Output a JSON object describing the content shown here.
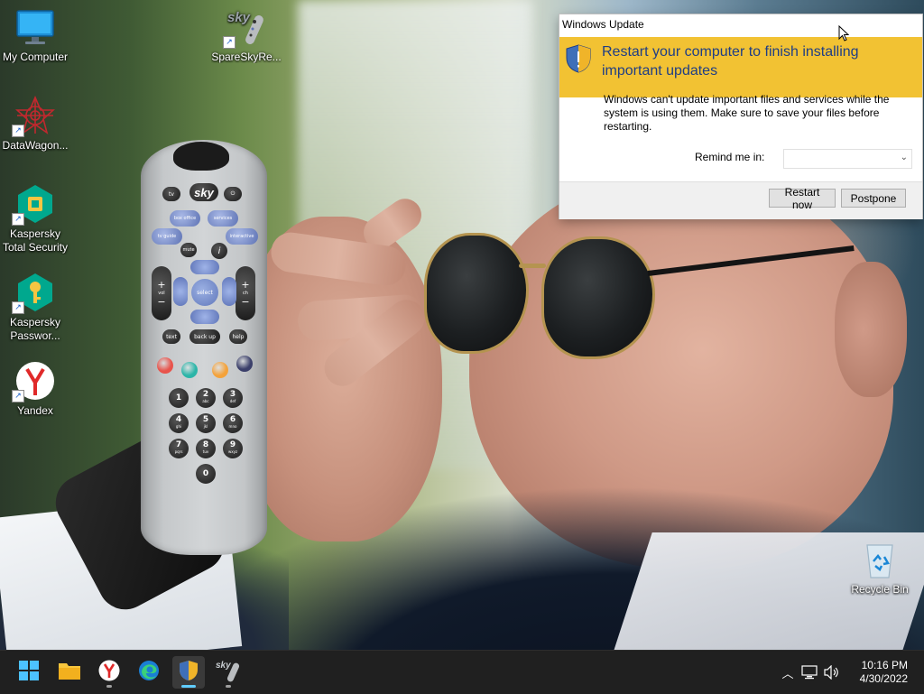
{
  "desktop": {
    "icons": [
      {
        "label": "My Computer",
        "icon": "monitor-icon",
        "shortcut": false
      },
      {
        "label": "DataWagon...",
        "icon": "datawagon-icon",
        "shortcut": true
      },
      {
        "label": "Kaspersky Total Security",
        "icon": "kaspersky-shield-icon",
        "shortcut": true
      },
      {
        "label": "Kaspersky Passwor...",
        "icon": "kaspersky-key-icon",
        "shortcut": true
      },
      {
        "label": "Yandex",
        "icon": "yandex-icon",
        "shortcut": true
      },
      {
        "label": "SpareSkyRe...",
        "icon": "sky-remote-icon",
        "shortcut": true
      },
      {
        "label": "Recycle Bin",
        "icon": "recycle-bin-icon",
        "shortcut": false
      }
    ]
  },
  "remote": {
    "brand": "sky",
    "top_row": [
      "tv",
      "sky",
      "power"
    ],
    "blue_row": [
      "box office",
      "services"
    ],
    "guide_row": [
      "tv guide",
      "interactive"
    ],
    "mute": "mute",
    "info": "i",
    "select": "select",
    "vol": "vol",
    "ch": "ch",
    "func_row": [
      "text",
      "back up",
      "help"
    ],
    "color_buttons": [
      "#e8534b",
      "#2bb5a8",
      "#f4a23a",
      "#3b3f6a"
    ],
    "numbers": [
      {
        "n": "1",
        "l": ""
      },
      {
        "n": "2",
        "l": "abc"
      },
      {
        "n": "3",
        "l": "def"
      },
      {
        "n": "4",
        "l": "ghi"
      },
      {
        "n": "5",
        "l": "jkl"
      },
      {
        "n": "6",
        "l": "mno"
      },
      {
        "n": "7",
        "l": "pqrs"
      },
      {
        "n": "8",
        "l": "tuv"
      },
      {
        "n": "9",
        "l": "wxyz"
      },
      {
        "n": "0",
        "l": ""
      }
    ]
  },
  "dialog": {
    "title": "Windows Update",
    "heading": "Restart your computer to finish installing important updates",
    "message": "Windows can't update important files and services while the system is using them. Make sure to save your files before restarting.",
    "remind_label": "Remind me in:",
    "remind_value": "",
    "restart_label": "Restart now",
    "postpone_label": "Postpone",
    "banner_color": "#f2c233",
    "heading_color": "#1f3e85"
  },
  "taskbar": {
    "items": [
      "start-icon",
      "file-explorer-icon",
      "yandex-icon",
      "edge-icon",
      "kaspersky-icon",
      "sky-remote-icon"
    ],
    "active_item": "kaspersky-icon",
    "tray_icons": [
      "chevron-up-icon",
      "network-icon",
      "volume-icon"
    ],
    "time": "10:16 PM",
    "date": "4/30/2022"
  }
}
